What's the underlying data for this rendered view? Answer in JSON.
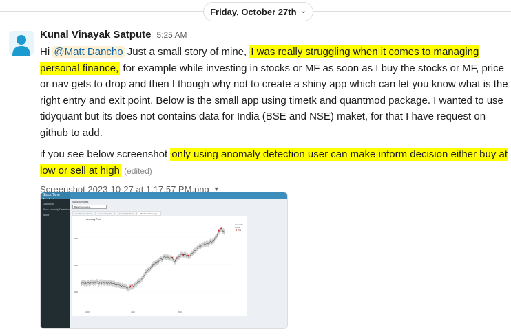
{
  "date_divider": {
    "label": "Friday, October 27th",
    "icon": "chevron-down-icon"
  },
  "message": {
    "author": "Kunal Vinayak Satpute",
    "time": "5:25 AM",
    "p1_pre": "Hi ",
    "mention": "@Matt Dancho",
    "p1_mid": " Just a small story of mine, ",
    "p1_highlight": "I was really struggling when it comes to managing personal finance,",
    "p1_post": " for example while investing in stocks or MF as soon as I buy the stocks or MF, price or nav gets to drop and then I though why not to create a shiny app which can let you know what is the right entry and exit point. Below is the small app using timetk and quantmod package. I wanted to use tidyquant but its does not contains data for India (BSE and NSE) maket, for that I have request on github to add.",
    "p2_pre": "if you see below screenshot ",
    "p2_highlight": "only using anomaly detection user can make inform decision either buy at low or sell at high",
    "edited": "(edited)"
  },
  "attachment": {
    "filename": "Screenshot 2023-10-27 at 1.17.57 PM.png",
    "caret_icon": "caret-down-icon"
  },
  "thumbnail": {
    "app_title": "Stock Time Analysis",
    "sidebar_items": [
      "Dashboard",
      "Stock Anomaly Detection",
      "About"
    ],
    "stock_label": "Stock Selected",
    "stock_value": "Bajaj Finance Ltd.",
    "tabs": [
      "Candlestick Chart",
      "Seasonality Plot",
      "Anomaly & Trend",
      "Backtest Strategies"
    ],
    "plot_title": "Anomaly Plot",
    "legend_title": "Anomaly",
    "legend_items": [
      "No",
      "Yes"
    ],
    "y_ticks": [
      "3000",
      "2000",
      "1000"
    ],
    "x_ticks": [
      "2018",
      "2020",
      "2022"
    ]
  },
  "colors": {
    "highlight": "#ffff00",
    "mention_bg": "#fdf0d3",
    "mention_text": "#1264a3",
    "app_header": "#3c8dbc",
    "app_sidebar": "#222d32",
    "anomaly": "#e41a1c"
  }
}
